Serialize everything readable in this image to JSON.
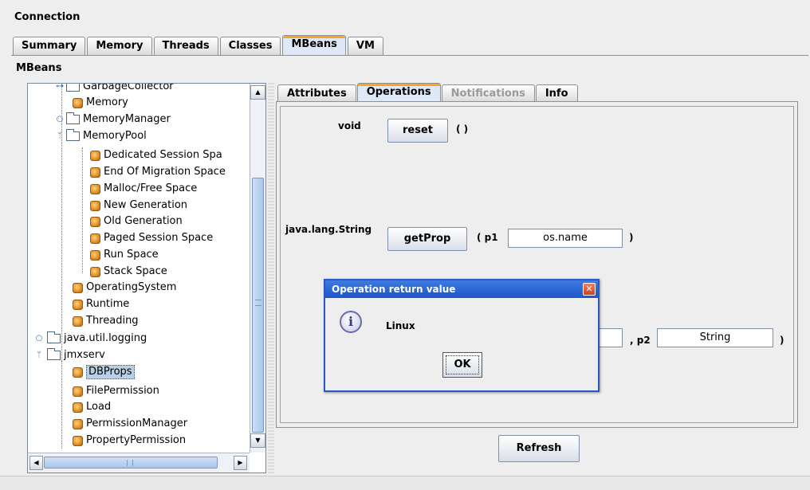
{
  "window": {
    "title": "Connection"
  },
  "main_tabs": [
    {
      "label": "Summary",
      "active": false
    },
    {
      "label": "Memory",
      "active": false
    },
    {
      "label": "Threads",
      "active": false
    },
    {
      "label": "Classes",
      "active": false
    },
    {
      "label": "MBeans",
      "active": true
    },
    {
      "label": "VM",
      "active": false
    }
  ],
  "mbeans_section": {
    "title": "MBeans"
  },
  "tree": {
    "items": [
      {
        "label": "GarbageCollector",
        "kind": "folder"
      },
      {
        "label": "Memory",
        "kind": "bean"
      },
      {
        "label": "MemoryManager",
        "kind": "folder"
      },
      {
        "label": "MemoryPool",
        "kind": "folder"
      },
      {
        "label": "Dedicated Session Spa",
        "kind": "bean"
      },
      {
        "label": "End Of Migration Space",
        "kind": "bean"
      },
      {
        "label": "Malloc/Free Space",
        "kind": "bean"
      },
      {
        "label": "New Generation",
        "kind": "bean"
      },
      {
        "label": "Old Generation",
        "kind": "bean"
      },
      {
        "label": "Paged Session Space",
        "kind": "bean"
      },
      {
        "label": "Run Space",
        "kind": "bean"
      },
      {
        "label": "Stack Space",
        "kind": "bean"
      },
      {
        "label": "OperatingSystem",
        "kind": "bean"
      },
      {
        "label": "Runtime",
        "kind": "bean"
      },
      {
        "label": "Threading",
        "kind": "bean"
      },
      {
        "label": "java.util.logging",
        "kind": "folder"
      },
      {
        "label": "jmxserv",
        "kind": "folder"
      },
      {
        "label": "DBProps",
        "kind": "bean",
        "selected": true
      },
      {
        "label": "FilePermission",
        "kind": "bean"
      },
      {
        "label": "Load",
        "kind": "bean"
      },
      {
        "label": "PermissionManager",
        "kind": "bean"
      },
      {
        "label": "PropertyPermission",
        "kind": "bean"
      }
    ]
  },
  "op_tabs": [
    {
      "label": "Attributes",
      "state": "normal"
    },
    {
      "label": "Operations",
      "state": "active"
    },
    {
      "label": "Notifications",
      "state": "disabled"
    },
    {
      "label": "Info",
      "state": "normal"
    }
  ],
  "operations": {
    "reset": {
      "return_type": "void",
      "button": "reset",
      "params": "( )"
    },
    "getProp": {
      "return_type": "java.lang.String",
      "button": "getProp",
      "param_open": "( p1",
      "p1_value": "os.name",
      "param_close": ")"
    },
    "third": {
      "p2_label": ", p2",
      "p2_value": "String",
      "param_close": ")"
    }
  },
  "dialog": {
    "title": "Operation return value",
    "message": "Linux",
    "ok_label": "OK",
    "icon": "info-icon"
  },
  "refresh_label": "Refresh",
  "colors": {
    "active_tab_accent": "#f5a623",
    "dialog_title_bar": "#1d56c9",
    "selection": "#b8cfe5"
  }
}
